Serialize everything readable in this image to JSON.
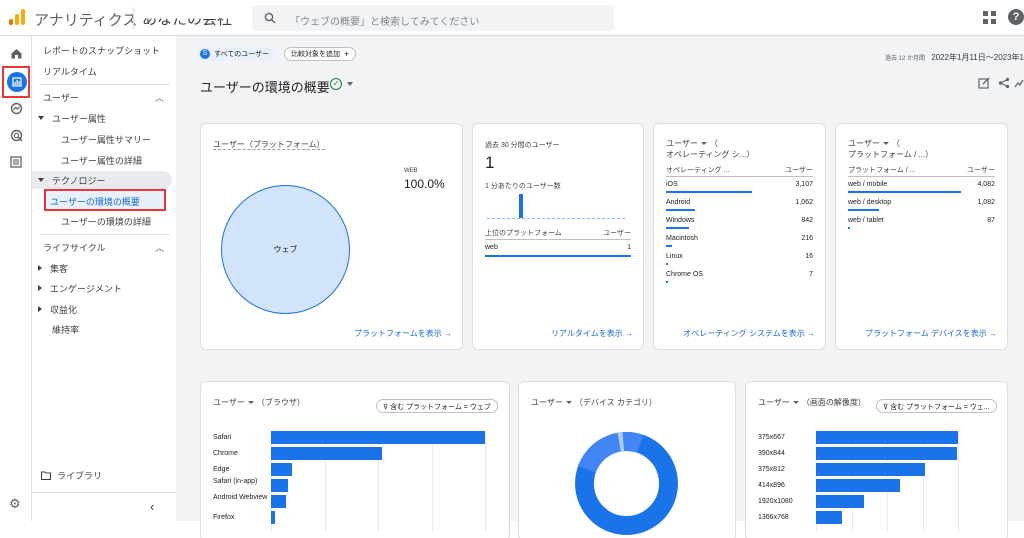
{
  "header": {
    "app_title": "アナリティクス",
    "account_name": "あなたの会社",
    "search_placeholder": "「ウェブの概要」と検索してみてください"
  },
  "nav": {
    "snapshot": "レポートのスナップショット",
    "realtime": "リアルタイム",
    "user_section": "ユーザー",
    "user_attributes": "ユーザー属性",
    "user_attr_summary": "ユーザー属性サマリー",
    "user_attr_detail": "ユーザー属性の詳細",
    "technology": "テクノロジー",
    "tech_overview": "ユーザーの環境の概要",
    "tech_detail": "ユーザーの環境の詳細",
    "lifecycle_section": "ライフサイクル",
    "acquisition": "集客",
    "engagement": "エンゲージメント",
    "monetization": "収益化",
    "retention": "維持率",
    "library": "ライブラリ"
  },
  "toolbar": {
    "segment_chip": "すべてのユーザー",
    "add_comparison": "比較対象を追加",
    "date_prefix": "過去 12 か月間",
    "date_range": "2022年1月11日～2023年1",
    "page_title": "ユーザーの環境の概要"
  },
  "cards": {
    "platform": {
      "title": "ユーザー（プラットフォーム）",
      "legend_label": "WEB",
      "legend_value": "100.0%",
      "pie_label": "ウェブ",
      "link": "プラットフォームを表示 →"
    },
    "realtime": {
      "label": "過去 30 分間のユーザー",
      "value": "1",
      "sub": "1 分あたりのユーザー数",
      "col1": "上位のプラットフォーム",
      "col2": "ユーザー",
      "row_name": "web",
      "row_value": "1",
      "link": "リアルタイムを表示 →"
    },
    "os": {
      "title_line1": "ユーザー",
      "title_line2": "オペレーティング シ...）",
      "col1": "オペレーティング ...",
      "col2": "ユーザー",
      "link": "オペレーティング システムを表示 →",
      "rows": [
        {
          "name": "iOS",
          "value": "3,107",
          "ratio": 1.0
        },
        {
          "name": "Android",
          "value": "1,062",
          "ratio": 0.34
        },
        {
          "name": "Windows",
          "value": "842",
          "ratio": 0.27
        },
        {
          "name": "Macintosh",
          "value": "216",
          "ratio": 0.07
        },
        {
          "name": "Linux",
          "value": "16",
          "ratio": 0.01
        },
        {
          "name": "Chrome OS",
          "value": "7",
          "ratio": 0.005
        }
      ]
    },
    "device": {
      "title_line1": "ユーザー",
      "title_line2": "プラットフォーム / ...）",
      "col1": "プラットフォーム / ...",
      "col2": "ユーザー",
      "link": "プラットフォーム デバイスを表示 →",
      "rows": [
        {
          "name": "web / mobile",
          "value": "4,082",
          "ratio": 1.0
        },
        {
          "name": "web / desktop",
          "value": "1,082",
          "ratio": 0.27
        },
        {
          "name": "web / tablet",
          "value": "87",
          "ratio": 0.02
        }
      ]
    },
    "browser": {
      "title": "ユーザー",
      "dim": "（ブラウザ）",
      "filter": "含む プラットフォーム = ウェブ",
      "rows": [
        {
          "name": "Safari",
          "ratio": 1.0
        },
        {
          "name": "Chrome",
          "ratio": 0.52
        },
        {
          "name": "Edge",
          "ratio": 0.1
        },
        {
          "name": "Safari (in-app)",
          "ratio": 0.08
        },
        {
          "name": "Android Webview",
          "ratio": 0.07
        },
        {
          "name": "Firefox",
          "ratio": 0.02
        }
      ]
    },
    "category": {
      "title": "ユーザー",
      "dim": "（デバイス カテゴリ）"
    },
    "resolution": {
      "title": "ユーザー",
      "dim": "（画面の解像度）",
      "filter": "含む プラットフォーム = ウェ...",
      "rows": [
        {
          "name": "375x667",
          "ratio": 1.0
        },
        {
          "name": "390x844",
          "ratio": 0.99
        },
        {
          "name": "375x812",
          "ratio": 0.77
        },
        {
          "name": "414x896",
          "ratio": 0.59
        },
        {
          "name": "1920x1080",
          "ratio": 0.34
        },
        {
          "name": "1366x768",
          "ratio": 0.18
        }
      ]
    }
  },
  "colors": {
    "accent": "#1a73e8",
    "highlight_border": "#e53935"
  }
}
